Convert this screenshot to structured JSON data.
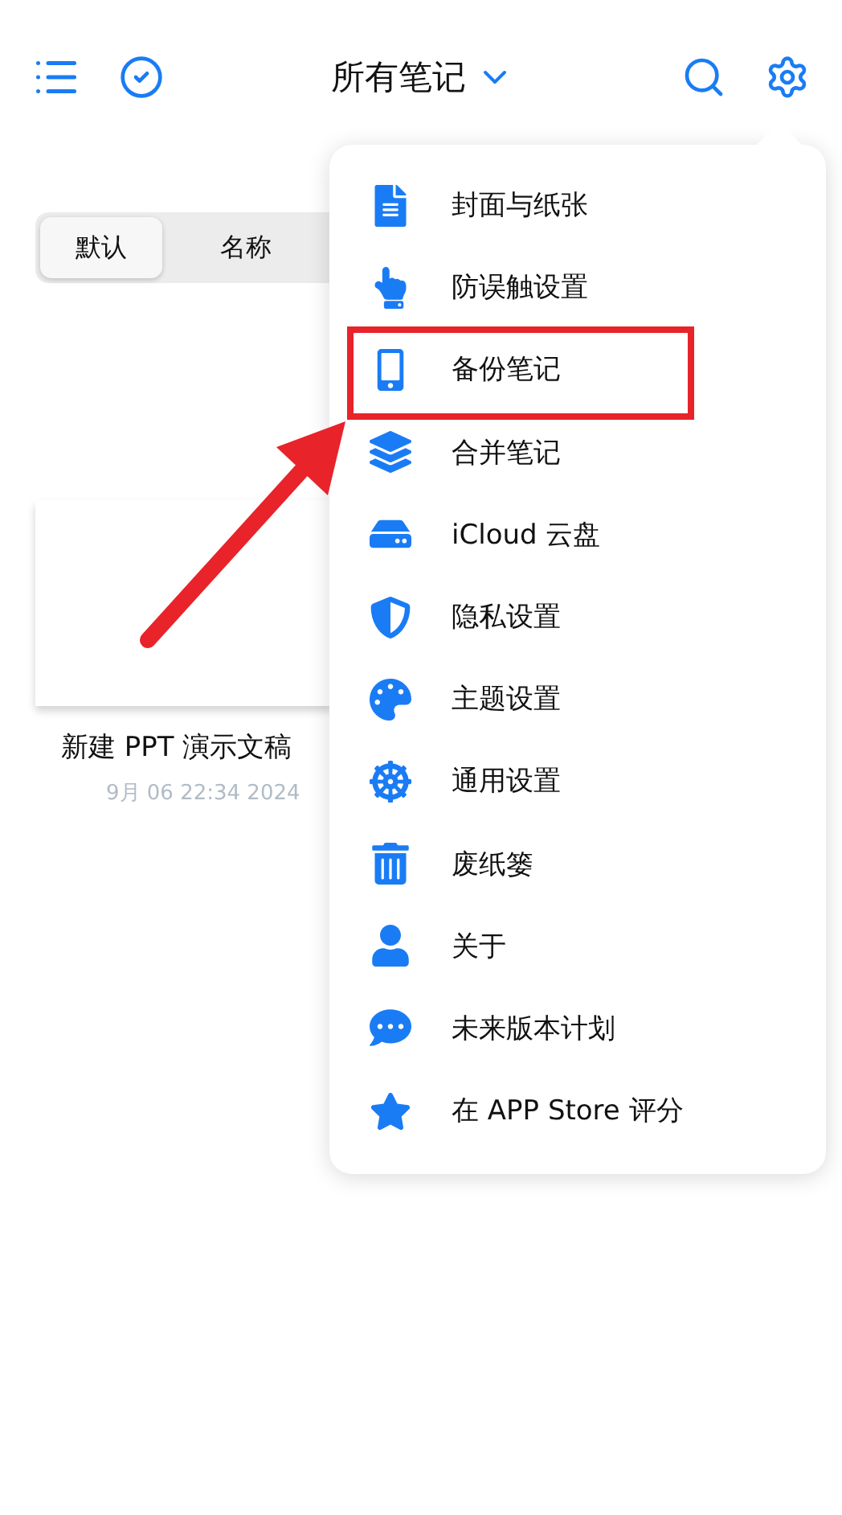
{
  "header": {
    "title": "所有笔记"
  },
  "sort_tabs": [
    {
      "label": "默认",
      "selected": true
    },
    {
      "label": "名称",
      "selected": false
    }
  ],
  "note": {
    "title": "新建 PPT 演示文稿",
    "date": "9月 06 22:34 2024"
  },
  "menu": {
    "items": [
      {
        "label": "封面与纸张",
        "highlighted": false
      },
      {
        "label": "防误触设置",
        "highlighted": false
      },
      {
        "label": "备份笔记",
        "highlighted": true
      },
      {
        "label": "合并笔记",
        "highlighted": false
      },
      {
        "label": "iCloud 云盘",
        "highlighted": false
      },
      {
        "label": "隐私设置",
        "highlighted": false
      },
      {
        "label": "主题设置",
        "highlighted": false
      },
      {
        "label": "通用设置",
        "highlighted": false
      },
      {
        "label": "废纸篓",
        "highlighted": false
      },
      {
        "label": "关于",
        "highlighted": false
      },
      {
        "label": "未来版本计划",
        "highlighted": false
      },
      {
        "label": "在 APP Store 评分",
        "highlighted": false
      }
    ]
  }
}
